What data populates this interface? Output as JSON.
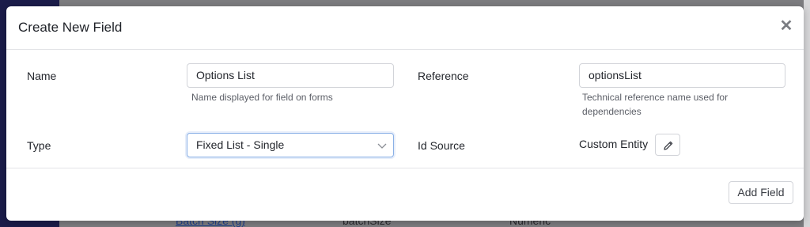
{
  "background": {
    "rows": [
      "Batch Size (g)",
      "batchSize",
      "Numeric"
    ]
  },
  "modal": {
    "title": "Create New Field",
    "close_icon": "close-icon",
    "fields": {
      "name": {
        "label": "Name",
        "value": "Options List",
        "help": "Name displayed for field on forms"
      },
      "reference": {
        "label": "Reference",
        "value": "optionsList",
        "help_line1": "Technical reference name used for",
        "help_line2": "dependencies"
      },
      "type": {
        "label": "Type",
        "selected": "Fixed List - Single",
        "icon": "chevron-down-icon"
      },
      "id_source": {
        "label": "Id Source",
        "value": "Custom Entity",
        "edit_icon": "pencil-icon"
      }
    },
    "footer": {
      "add_label": "Add Field"
    }
  }
}
